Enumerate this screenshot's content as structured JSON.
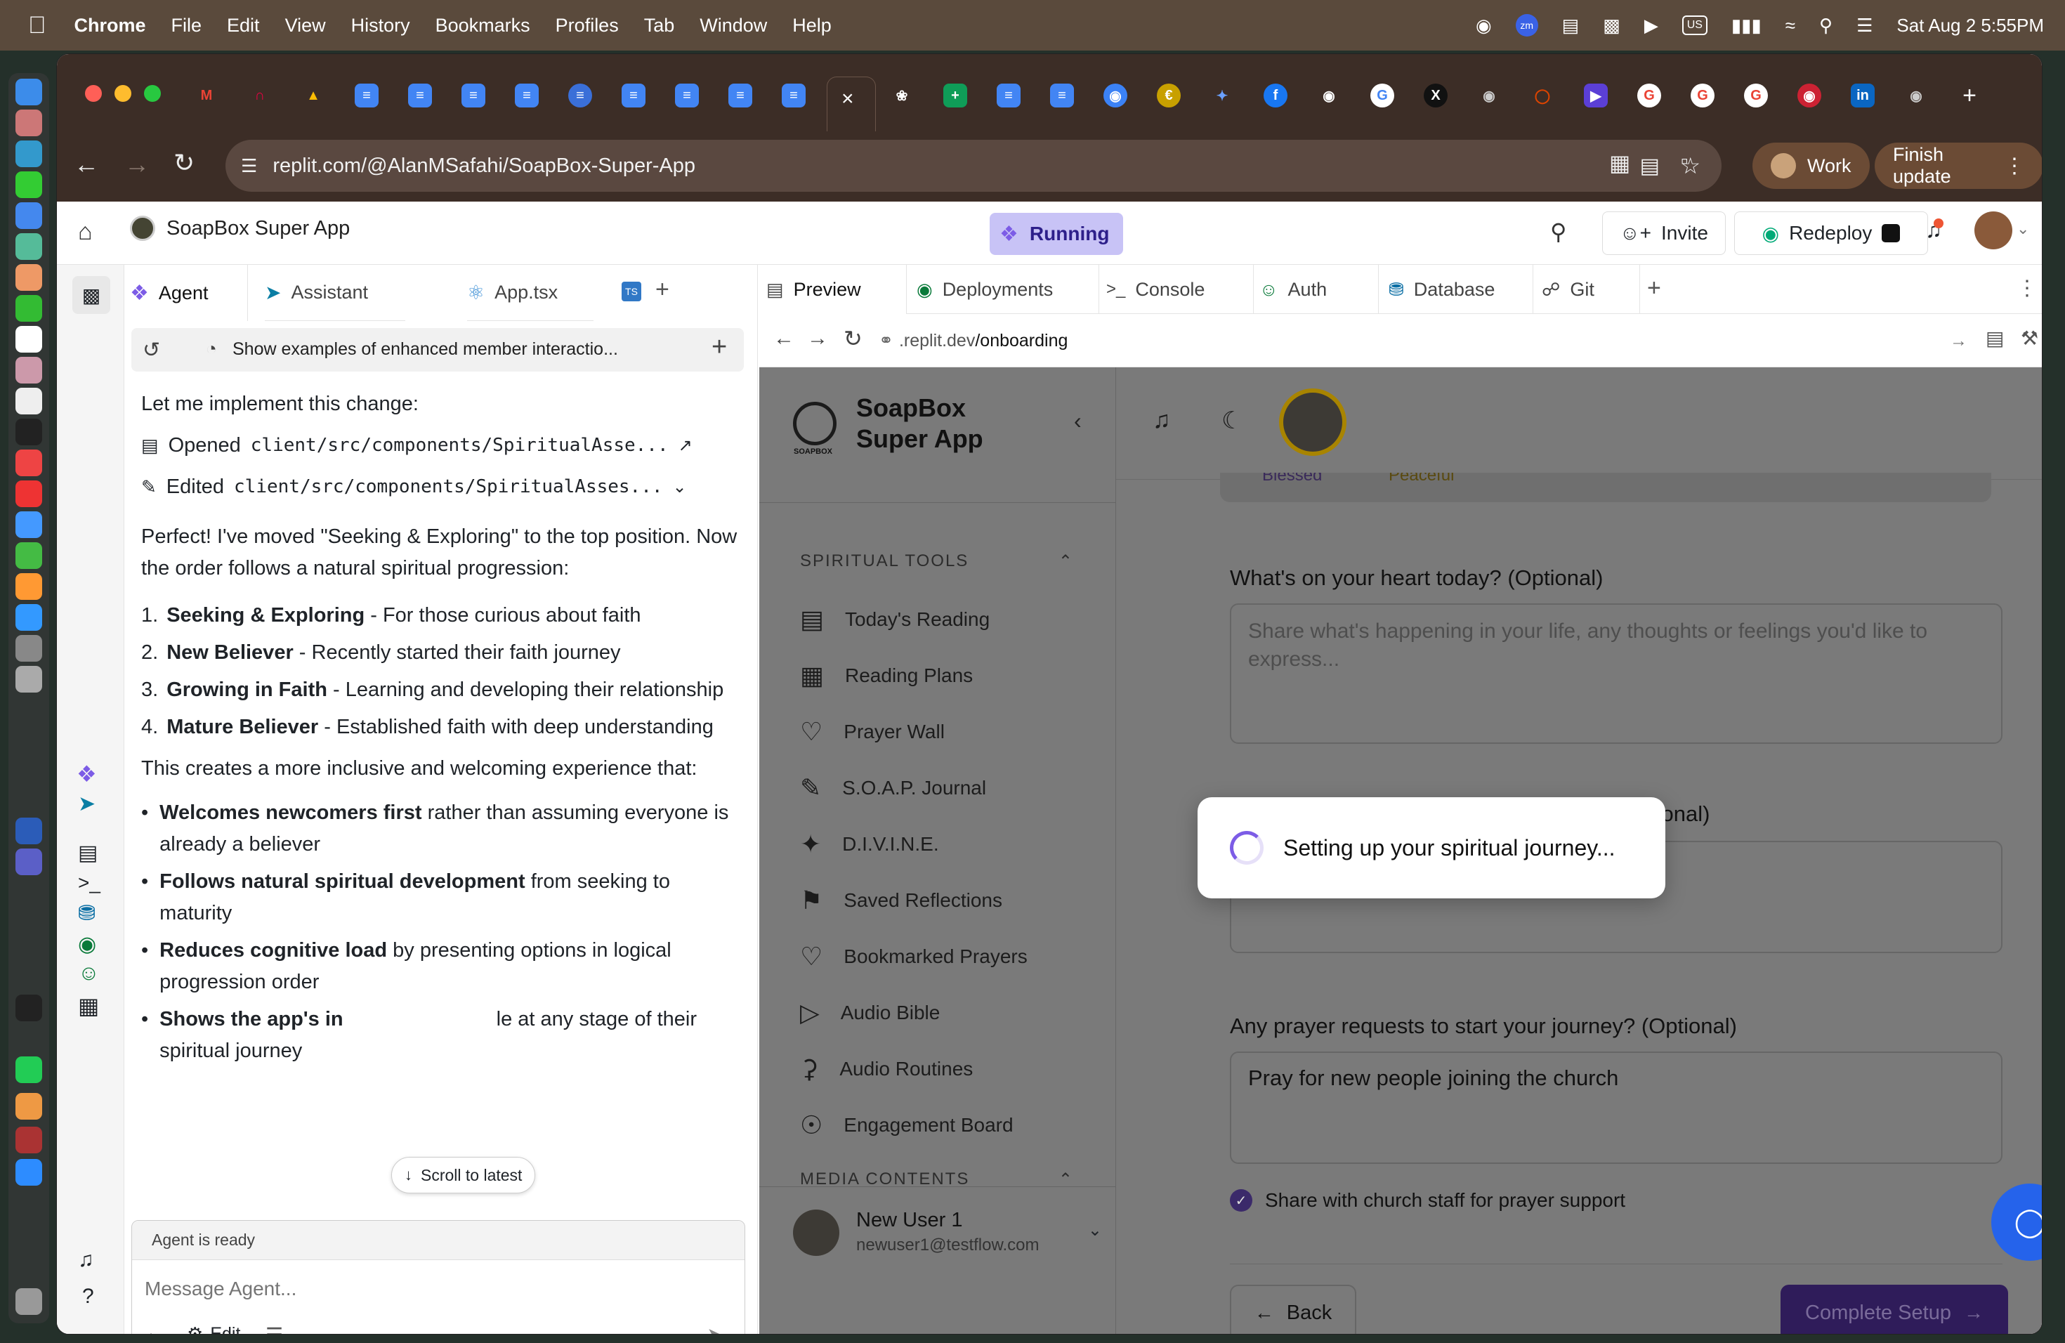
{
  "menubar": {
    "app": "Chrome",
    "items": [
      "File",
      "Edit",
      "View",
      "History",
      "Bookmarks",
      "Profiles",
      "Tab",
      "Window",
      "Help"
    ],
    "keyboard": "US",
    "datetime": "Sat Aug 2  5:55PM"
  },
  "browser": {
    "url": "replit.com/@AlanMSafahi/SoapBox-Super-App",
    "profile_label": "Work",
    "update_label": "Finish update"
  },
  "replit": {
    "project_name": "SoapBox Super App",
    "status": "Running",
    "invite_label": "Invite",
    "redeploy_label": "Redeploy",
    "left_tabs": [
      "Agent",
      "Assistant",
      "App.tsx"
    ],
    "right_tabs": [
      "Preview",
      "Deployments",
      "Console",
      "Auth",
      "Database",
      "Git"
    ],
    "preview_url_prefix": ".replit.dev",
    "preview_url_path": "/onboarding"
  },
  "agent": {
    "thread_title": "Show examples of enhanced member interactio...",
    "intro": "Let me implement this change:",
    "opened_label": "Opened",
    "opened_file": "client/src/components/SpiritualAsse...",
    "edited_label": "Edited",
    "edited_file": "client/src/components/SpiritualAsses...",
    "summary": "Perfect! I've moved \"Seeking & Exploring\" to the top position. Now the order follows a natural spiritual progression:",
    "steps": [
      {
        "num": "1.",
        "bold": "Seeking & Exploring",
        "text": " - For those curious about faith"
      },
      {
        "num": "2.",
        "bold": "New Believer",
        "text": " - Recently started their faith journey"
      },
      {
        "num": "3.",
        "bold": "Growing in Faith",
        "text": " - Learning and developing their relationship"
      },
      {
        "num": "4.",
        "bold": "Mature Believer",
        "text": " - Established faith with deep understanding"
      }
    ],
    "inclusive": "This creates a more inclusive and welcoming experience that:",
    "bullets": [
      {
        "bold": "Welcomes newcomers first",
        "text": " rather than assuming everyone is already a believer"
      },
      {
        "bold": "Follows natural spiritual development",
        "text": " from seeking to maturity"
      },
      {
        "bold": "Reduces cognitive load",
        "text": " by presenting options in logical progression order"
      },
      {
        "bold": "Shows the app's in",
        "text": "le at any stage of their spiritual journey"
      }
    ],
    "scroll_latest": "Scroll to latest",
    "status": "Agent is ready",
    "input_placeholder": "Message Agent...",
    "edit_label": "Edit"
  },
  "soapbox": {
    "brand_line1": "SoapBox",
    "brand_line2": "Super App",
    "logo_text": "SOAPBOX",
    "section_tools": "SPIRITUAL TOOLS",
    "nav": [
      {
        "label": "Today's Reading",
        "icon": "book-icon"
      },
      {
        "label": "Reading Plans",
        "icon": "calendar-icon"
      },
      {
        "label": "Prayer Wall",
        "icon": "heart-icon"
      },
      {
        "label": "S.O.A.P. Journal",
        "icon": "pen-icon"
      },
      {
        "label": "D.I.V.I.N.E.",
        "icon": "sparkle-icon"
      },
      {
        "label": "Saved Reflections",
        "icon": "bookmark-icon"
      },
      {
        "label": "Bookmarked Prayers",
        "icon": "heart-icon"
      },
      {
        "label": "Audio Bible",
        "icon": "play-icon"
      },
      {
        "label": "Audio Routines",
        "icon": "mic-icon"
      },
      {
        "label": "Engagement Board",
        "icon": "trophy-icon"
      }
    ],
    "section_media": "MEDIA CONTENTS",
    "user_name": "New User 1",
    "user_email": "newuser1@testflow.com",
    "mood_chips": [
      "Blessed",
      "Peaceful"
    ],
    "q_heart": "What's on your heart today? (Optional)",
    "q_heart_placeholder": "Share what's happening in your life, any thoughts or feelings you'd like to express...",
    "q_community": "unity? (Optional)",
    "q_prayer": "Any prayer requests to start your journey? (Optional)",
    "q_prayer_value": "Pray for new people joining the church",
    "share_label": "Share with church staff for prayer support",
    "back_label": "Back",
    "complete_label": "Complete Setup",
    "loading_text": "Setting up your spiritual journey..."
  }
}
